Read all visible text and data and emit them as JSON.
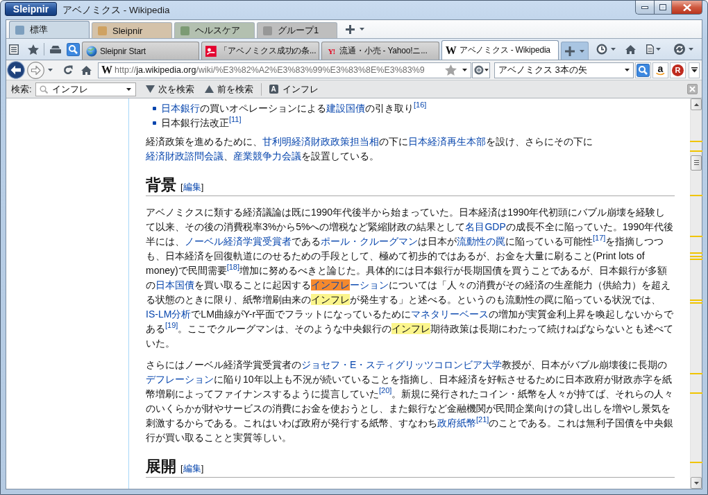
{
  "window": {
    "app_button": "Sleipnir",
    "title": "アベノミクス - Wikipedia"
  },
  "tab_groups": [
    {
      "label": "標準",
      "color": "#7d9fbe",
      "selected": true
    },
    {
      "label": "Sleipnir",
      "color": "#cfa262",
      "selected": false
    },
    {
      "label": "ヘルスケア",
      "color": "#7c9b74",
      "selected": false
    },
    {
      "label": "グループ1",
      "color": "#979797",
      "selected": false
    }
  ],
  "tabs": [
    {
      "title": "Sleipnir Start",
      "icon": {
        "kind": "globe"
      },
      "selected": false
    },
    {
      "title": "「アベノミクス成功の条...",
      "icon": {
        "kind": "tile"
      },
      "selected": false
    },
    {
      "title": "流通・小売 - Yahoo!ニ...",
      "icon": {
        "kind": "mark",
        "glyph": "Y!"
      },
      "selected": false
    },
    {
      "title": "アベノミクス - Wikipedia",
      "icon": {
        "kind": "letter",
        "glyph": "W"
      },
      "selected": true
    }
  ],
  "address_bar": {
    "site_glyph": "W",
    "url": [
      {
        "text": "http://",
        "strong": false
      },
      {
        "text": "ja.wikipedia.org",
        "strong": true
      },
      {
        "text": "/wiki/%E3%82%A2%E3%83%99%E3%83%8E%E3%83%9",
        "strong": false
      }
    ]
  },
  "search_box": {
    "value": "アベノミクス 3本の矢",
    "engines": [
      {
        "kind": "magnifier"
      },
      {
        "kind": "smile",
        "glyph": "a"
      },
      {
        "kind": "disc",
        "glyph": "R"
      }
    ]
  },
  "find_bar": {
    "label": "検索:",
    "query": "インフレ",
    "next": "次を検索",
    "previous": "前を検索",
    "highlight_glyph": "A",
    "highlight_label": "インフレ"
  },
  "article": {
    "blocks": [
      {
        "kind": "list",
        "items": [
          {
            "segments": [
              {
                "kind": "link",
                "text": "日本銀行"
              },
              {
                "kind": "text",
                "text": "の買いオペレーションによる"
              },
              {
                "kind": "link",
                "text": "建設国債"
              },
              {
                "kind": "text",
                "text": "の引き取り"
              },
              {
                "kind": "ref",
                "text": "[16]"
              }
            ]
          },
          {
            "segments": [
              {
                "kind": "text",
                "text": "日本銀行法改正"
              },
              {
                "kind": "ref",
                "text": "[11]"
              }
            ]
          }
        ]
      },
      {
        "kind": "paragraph",
        "segments": [
          {
            "kind": "text",
            "text": "経済政策を進めるために、"
          },
          {
            "kind": "link",
            "text": "甘利明経済財政政策担当相"
          },
          {
            "kind": "text",
            "text": "の下に"
          },
          {
            "kind": "link",
            "text": "日本経済再生本部"
          },
          {
            "kind": "text",
            "text": "を設け、さらにその下に"
          },
          {
            "kind": "link",
            "text": "経済財政諮問会議"
          },
          {
            "kind": "text",
            "text": "、"
          },
          {
            "kind": "link",
            "text": "産業競争力会議"
          },
          {
            "kind": "text",
            "text": "を設置している。"
          }
        ]
      },
      {
        "kind": "heading",
        "title": "背景",
        "edit": {
          "open": "[",
          "link": "編集",
          "close": "]"
        }
      },
      {
        "kind": "paragraph",
        "segments": [
          {
            "kind": "text",
            "text": "アベノミクスに類する経済議論は既に1990年代後半から始まっていた。日本経済は1990年代初頭にバブル崩壊を経験して以来、その後の消費税率3%から5%への増税など緊縮財政の結果として"
          },
          {
            "kind": "link",
            "text": "名目GDP"
          },
          {
            "kind": "text",
            "text": "の成長不全に陥っていた。1990年代後半には、"
          },
          {
            "kind": "link",
            "text": "ノーベル経済学賞受賞者"
          },
          {
            "kind": "text",
            "text": "である"
          },
          {
            "kind": "link",
            "text": "ポール・クルーグマン"
          },
          {
            "kind": "text",
            "text": "は日本が"
          },
          {
            "kind": "link",
            "text": "流動性の罠"
          },
          {
            "kind": "text",
            "text": "に陥っている可能性"
          },
          {
            "kind": "ref",
            "text": "[17]"
          },
          {
            "kind": "text",
            "text": "を指摘しつつも、日本経済を回復軌道にのせるための手段として、極めて初歩的ではあるが、お金を大量に刷ること(Print lots of money)で民間需要"
          },
          {
            "kind": "ref",
            "text": "[18]"
          },
          {
            "kind": "text",
            "text": "増加に努めるべきと論じた。具体的には日本銀行が長期国債を買うことであるが、日本銀行が多額の"
          },
          {
            "kind": "link",
            "text": "日本国債"
          },
          {
            "kind": "text",
            "text": "を買い取ることに起因する"
          },
          {
            "kind": "link",
            "text": "ーション",
            "match": {
              "text": "インフレ",
              "current": true
            }
          },
          {
            "kind": "text",
            "text": "については「人々の消費がその経済の生産能力（供給力）を超える状態のときに限り、紙幣増刷由来の"
          },
          {
            "kind": "match",
            "text": "インフレ",
            "current": false
          },
          {
            "kind": "text",
            "text": "が発生する」と述べる。というのも流動性の罠に陥っている状況では、"
          },
          {
            "kind": "link",
            "text": "IS-LM分析"
          },
          {
            "kind": "text",
            "text": "でLM曲線がY-r平面でフラットになっているために"
          },
          {
            "kind": "link",
            "text": "マネタリーベース"
          },
          {
            "kind": "text",
            "text": "の増加が実質金利上昇を喚起しないからである"
          },
          {
            "kind": "ref",
            "text": "[19]"
          },
          {
            "kind": "text",
            "text": "。ここでクルーグマンは、そのような中央銀行の"
          },
          {
            "kind": "match",
            "text": "インフレ",
            "current": false
          },
          {
            "kind": "text",
            "text": "期待政策は長期にわたって続けねばならないとも述べていた。"
          }
        ]
      },
      {
        "kind": "paragraph",
        "segments": [
          {
            "kind": "text",
            "text": "さらにはノーベル経済学賞受賞者の"
          },
          {
            "kind": "link",
            "text": "ジョセフ・E・スティグリッツ"
          },
          {
            "kind": "link",
            "text": "コロンビア大学"
          },
          {
            "kind": "text",
            "text": "教授が、日本がバブル崩壊後に長期の"
          },
          {
            "kind": "link",
            "text": "デフレーション"
          },
          {
            "kind": "text",
            "text": "に陥り10年以上も不況が続いていることを指摘し、日本経済を好転させるために日本政府が財政赤字を紙幣増刷によってファイナンスするように提言していた"
          },
          {
            "kind": "ref",
            "text": "[20]"
          },
          {
            "kind": "text",
            "text": "。新規に発行されたコイン・紙幣を人々が持てば、それらの人々のいくらかが財やサービスの消費にお金を使おうとし、また銀行など金融機関が民間企業向けの貸し出しを増やし景気を刺激するからである。これはいわば政府が発行する紙幣、すなわち"
          },
          {
            "kind": "link",
            "text": "政府紙幣"
          },
          {
            "kind": "ref",
            "text": "[21]"
          },
          {
            "kind": "text",
            "text": "のことである。これは無利子国債を中央銀行が買い取ることと実質等しい。"
          }
        ]
      },
      {
        "kind": "heading",
        "title": "展開",
        "edit": {
          "open": "[",
          "link": "編集",
          "close": "]"
        }
      }
    ]
  }
}
